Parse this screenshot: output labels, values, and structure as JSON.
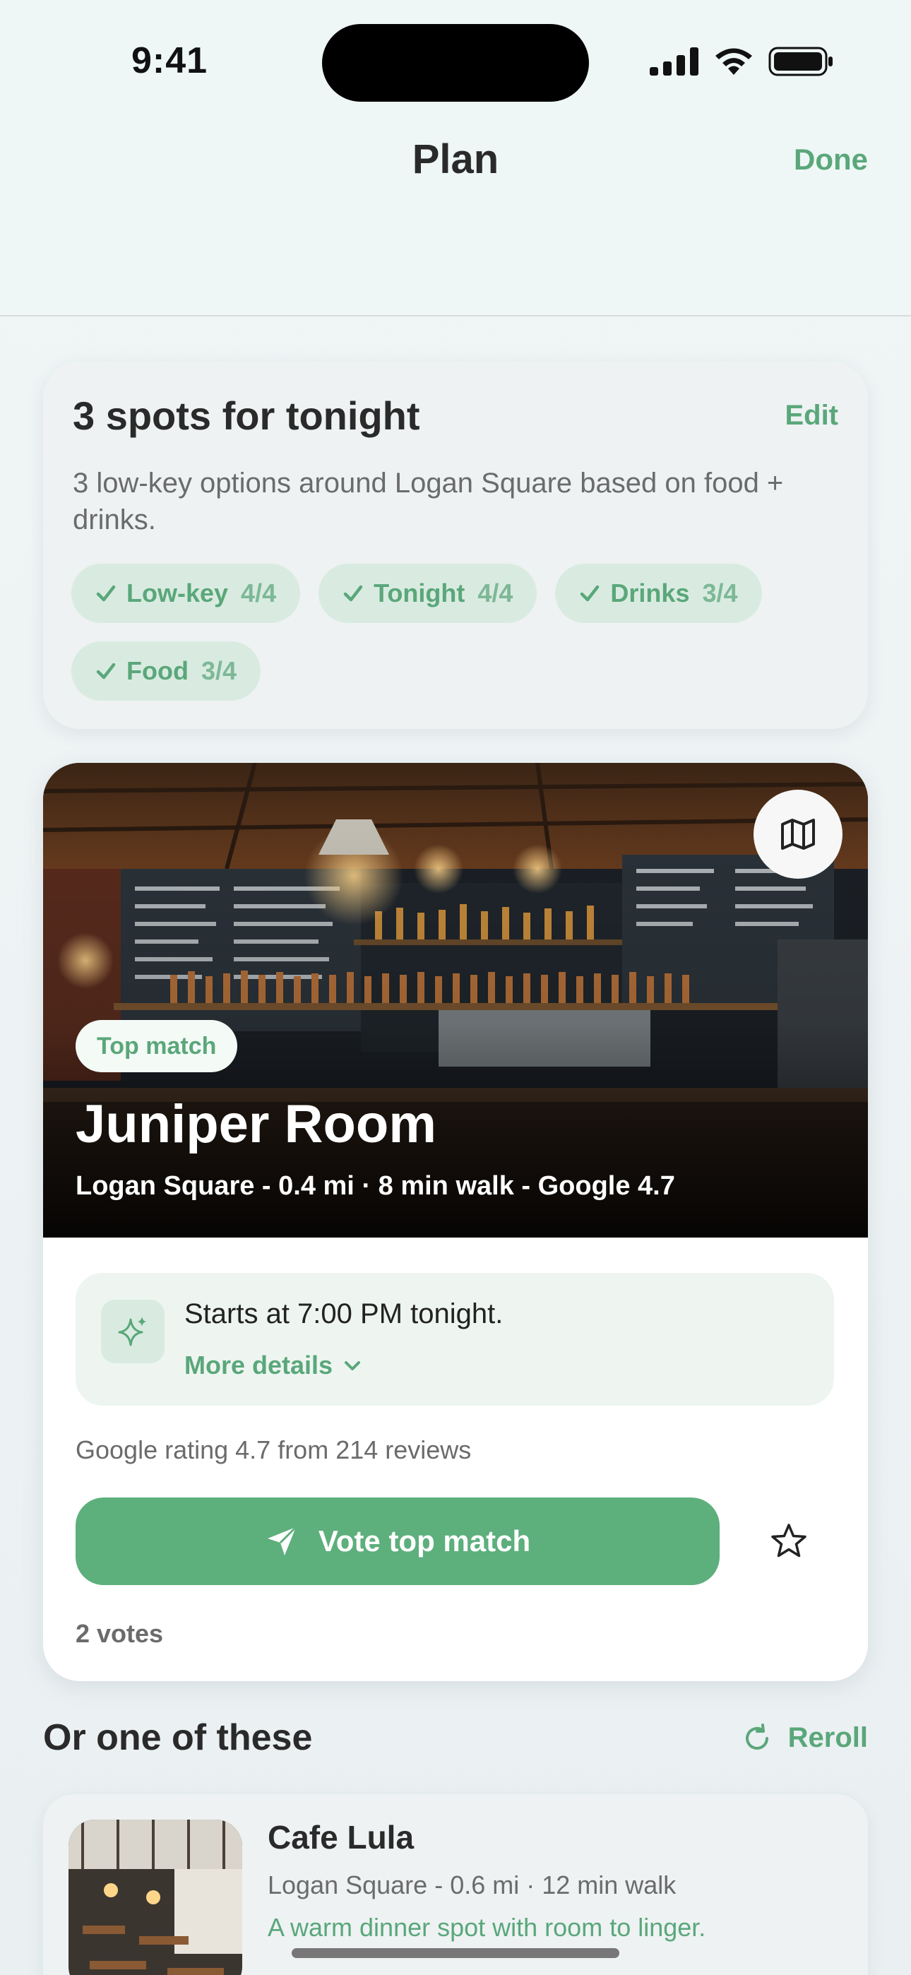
{
  "status_bar": {
    "time": "9:41"
  },
  "nav": {
    "title": "Plan",
    "done_label": "Done"
  },
  "summary": {
    "title": "3 spots for tonight",
    "edit_label": "Edit",
    "description": "3 low-key options around Logan Square based on food + drinks.",
    "chips": [
      {
        "label": "Low-key",
        "count": "4/4"
      },
      {
        "label": "Tonight",
        "count": "4/4"
      },
      {
        "label": "Drinks",
        "count": "3/4"
      },
      {
        "label": "Food",
        "count": "3/4"
      }
    ]
  },
  "top_match": {
    "badge": "Top match",
    "name": "Juniper Room",
    "meta": "Logan Square - 0.4 mi · 8 min walk - Google 4.7",
    "info_text": "Starts at 7:00 PM tonight.",
    "more_details_label": "More details",
    "rating_line": "Google rating 4.7 from 214 reviews",
    "vote_label": "Vote top match",
    "votes": "2 votes"
  },
  "alternatives": {
    "title": "Or one of these",
    "reroll_label": "Reroll",
    "items": [
      {
        "name": "Cafe Lula",
        "meta": "Logan Square - 0.6 mi · 12 min walk",
        "description": "A warm dinner spot with room to linger."
      }
    ]
  },
  "colors": {
    "accent": "#5aa77a",
    "accent_button": "#5daf7c",
    "chip_bg": "#d9ebe1"
  },
  "icons": [
    "signal-icon",
    "wifi-icon",
    "battery-icon",
    "map-icon",
    "check-icon",
    "sparkle-icon",
    "chevron-down-icon",
    "send-icon",
    "star-icon",
    "reroll-icon"
  ]
}
